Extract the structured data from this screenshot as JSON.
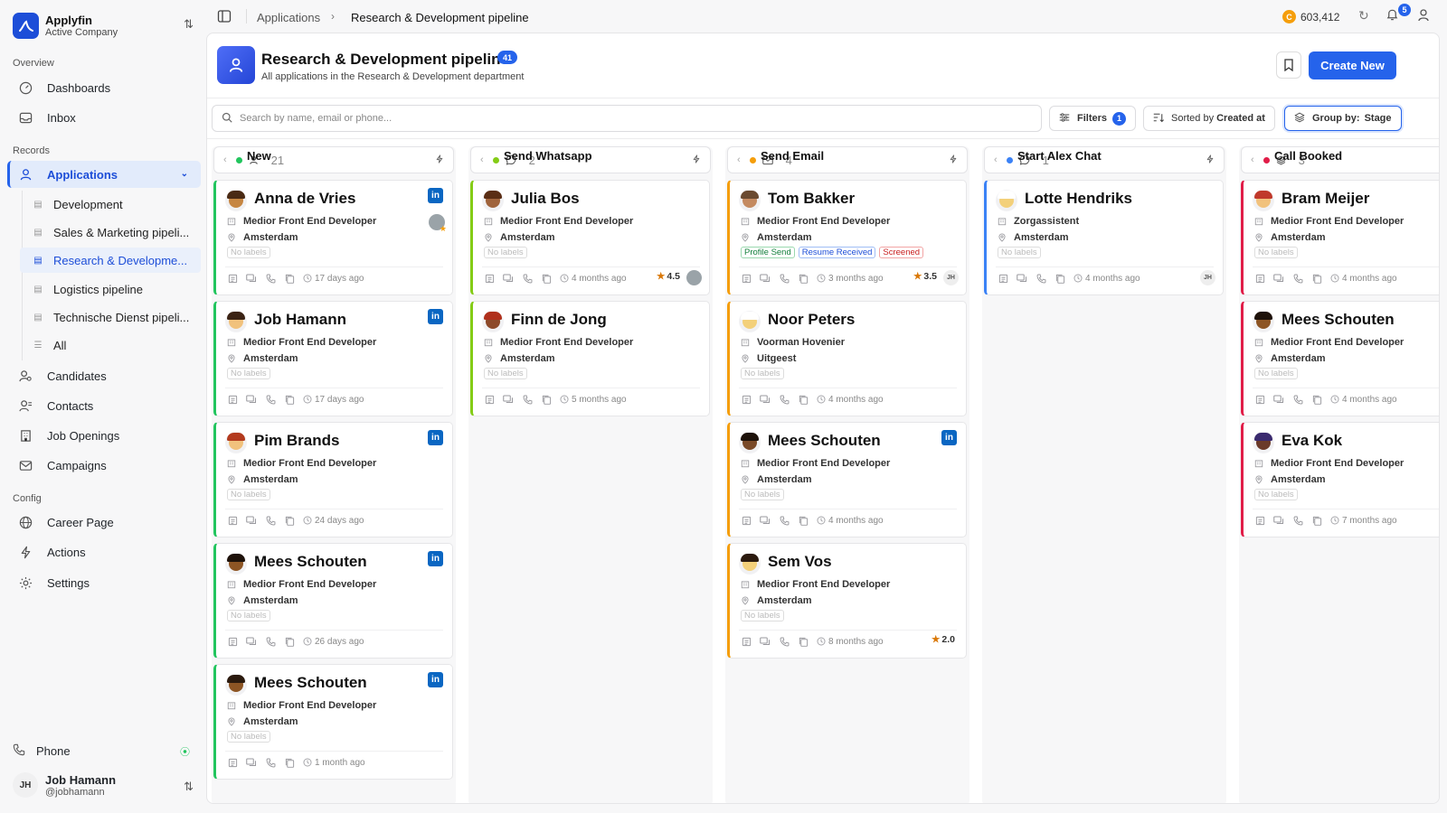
{
  "company": {
    "name": "Applyfin",
    "subtitle": "Active Company"
  },
  "sections": {
    "overview": "Overview",
    "records": "Records",
    "config": "Config"
  },
  "nav": {
    "dashboards": "Dashboards",
    "inbox": "Inbox",
    "applications": "Applications",
    "candidates": "Candidates",
    "contacts": "Contacts",
    "job_openings": "Job Openings",
    "campaigns": "Campaigns",
    "career_page": "Career Page",
    "actions": "Actions",
    "settings": "Settings",
    "phone": "Phone"
  },
  "subnav": [
    "Development",
    "Sales & Marketing pipeli...",
    "Research & Developme...",
    "Logistics pipeline",
    "Technische Dienst pipeli...",
    "All"
  ],
  "user": {
    "name": "Job Hamann",
    "handle": "@jobhamann",
    "initials": "JH"
  },
  "topbar": {
    "crumb_root": "Applications",
    "crumb_current": "Research & Development pipeline",
    "credits": "603,412",
    "notifications": "5"
  },
  "page": {
    "title": "Research & Development pipeline",
    "count": "41",
    "subtitle": "All applications in the Research & Development department",
    "create_label": "Create New"
  },
  "toolbar": {
    "search_placeholder": "Search by name, email or phone...",
    "filters_label": "Filters",
    "filters_count": "1",
    "sort_prefix": "Sorted by",
    "sort_value": "Created at",
    "group_prefix": "Group by:",
    "group_value": "Stage"
  },
  "colors": {
    "accent": "#2563eb",
    "new": "#22c55e",
    "whatsapp": "#84cc16",
    "email": "#f59e0b",
    "chat": "#3b82f6",
    "booked": "#e11d48"
  },
  "columns": [
    {
      "name": "New",
      "count": "21",
      "cards": [
        {
          "name": "Anna de Vries",
          "role": "Medior Front End Developer",
          "location": "Amsterdam",
          "labels": [
            "No labels"
          ],
          "time": "17 days ago"
        },
        {
          "name": "Job Hamann",
          "role": "Medior Front End Developer",
          "location": "Amsterdam",
          "labels": [
            "No labels"
          ],
          "time": "17 days ago"
        },
        {
          "name": "Pim Brands",
          "role": "Medior Front End Developer",
          "location": "Amsterdam",
          "labels": [
            "No labels"
          ],
          "time": "24 days ago"
        },
        {
          "name": "Mees Schouten",
          "role": "Medior Front End Developer",
          "location": "Amsterdam",
          "labels": [
            "No labels"
          ],
          "time": "26 days ago"
        },
        {
          "name": "Mees Schouten",
          "role": "Medior Front End Developer",
          "location": "Amsterdam",
          "labels": [
            "No labels"
          ],
          "time": "1 month ago"
        }
      ]
    },
    {
      "name": "Send Whatsapp",
      "count": "2",
      "cards": [
        {
          "name": "Julia Bos",
          "role": "Medior Front End Developer",
          "location": "Amsterdam",
          "labels": [
            "No labels"
          ],
          "time": "4 months ago",
          "rating": "4.5"
        },
        {
          "name": "Finn de Jong",
          "role": "Medior Front End Developer",
          "location": "Amsterdam",
          "labels": [
            "No labels"
          ],
          "time": "5 months ago"
        }
      ]
    },
    {
      "name": "Send Email",
      "count": "4",
      "cards": [
        {
          "name": "Tom Bakker",
          "role": "Medior Front End Developer",
          "location": "Amsterdam",
          "labels": [
            "Profile Send",
            "Resume Received",
            "Screened"
          ],
          "time": "3 months ago",
          "rating": "3.5",
          "initials": "JH"
        },
        {
          "name": "Noor Peters",
          "role": "Voorman Hovenier",
          "location": "Uitgeest",
          "labels": [
            "No labels"
          ],
          "time": "4 months ago"
        },
        {
          "name": "Mees Schouten",
          "role": "Medior Front End Developer",
          "location": "Amsterdam",
          "labels": [
            "No labels"
          ],
          "time": "4 months ago"
        },
        {
          "name": "Sem Vos",
          "role": "Medior Front End Developer",
          "location": "Amsterdam",
          "labels": [
            "No labels"
          ],
          "time": "8 months ago",
          "rating": "2.0"
        }
      ]
    },
    {
      "name": "Start Alex Chat",
      "count": "1",
      "cards": [
        {
          "name": "Lotte Hendriks",
          "role": "Zorgassistent",
          "location": "Amsterdam",
          "labels": [
            "No labels"
          ],
          "time": "4 months ago",
          "initials": "JH"
        }
      ]
    },
    {
      "name": "Call Booked",
      "count": "3",
      "cards": [
        {
          "name": "Bram Meijer",
          "role": "Medior Front End Developer",
          "location": "Amsterdam",
          "labels": [
            "No labels"
          ],
          "time": "4 months ago"
        },
        {
          "name": "Mees Schouten",
          "role": "Medior Front End Developer",
          "location": "Amsterdam",
          "labels": [
            "No labels"
          ],
          "time": "4 months ago"
        },
        {
          "name": "Eva Kok",
          "role": "Medior Front End Developer",
          "location": "Amsterdam",
          "labels": [
            "No labels"
          ],
          "time": "7 months ago"
        }
      ]
    }
  ]
}
